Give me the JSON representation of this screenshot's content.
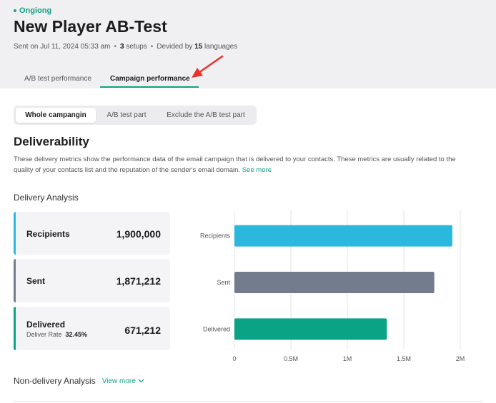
{
  "header": {
    "status": "Ongiong",
    "title": "New Player AB-Test",
    "meta": {
      "sent_on": "Sent on Jul 11, 2024 05:33 am",
      "setups_count": "3",
      "setups_label": "setups",
      "divided_prefix": "Devided by",
      "languages_count": "15",
      "languages_label": "languages"
    }
  },
  "tabs": [
    {
      "label": "A/B test performance",
      "active": false
    },
    {
      "label": "Campaign performance",
      "active": true
    }
  ],
  "segments": [
    {
      "label": "Whole campangin",
      "active": true
    },
    {
      "label": "A/B test part",
      "active": false
    },
    {
      "label": "Exclude the A/B test part",
      "active": false
    }
  ],
  "deliverability": {
    "title": "Deliverability",
    "description": "These delivery metrics show the performance data of the email campaign that is delivered to your contacts. These metrics are usually related to the quality of your contacts list and the reputation of the sender's email domain.",
    "see_more": "See more"
  },
  "delivery_analysis": {
    "title": "Delivery Analysis",
    "cards": [
      {
        "label": "Recipients",
        "value": "1,900,000",
        "color": "#2bb8de"
      },
      {
        "label": "Sent",
        "value": "1,871,212",
        "color": "#727c8c"
      },
      {
        "label": "Delivered",
        "value": "671,212",
        "color": "#0aa385",
        "rate_label": "Deliver Rate",
        "rate_value": "32.45%"
      }
    ]
  },
  "chart_data": {
    "type": "bar",
    "orientation": "horizontal",
    "categories": [
      "Recipients",
      "Sent",
      "Delivered"
    ],
    "values": [
      1930000,
      1770000,
      1350000
    ],
    "colors": [
      "#2bb8de",
      "#727c8c",
      "#0aa385"
    ],
    "xlim": [
      0,
      2000000
    ],
    "xticks": [
      0,
      500000,
      1000000,
      1500000,
      2000000
    ],
    "xtick_labels": [
      "0",
      "0.5M",
      "1M",
      "1.5M",
      "2M"
    ],
    "grid": true
  },
  "non_delivery": {
    "title": "Non-delivery Analysis",
    "view_more": "View more"
  },
  "colors": {
    "accent": "#14a085",
    "arrow": "#e8322b"
  }
}
